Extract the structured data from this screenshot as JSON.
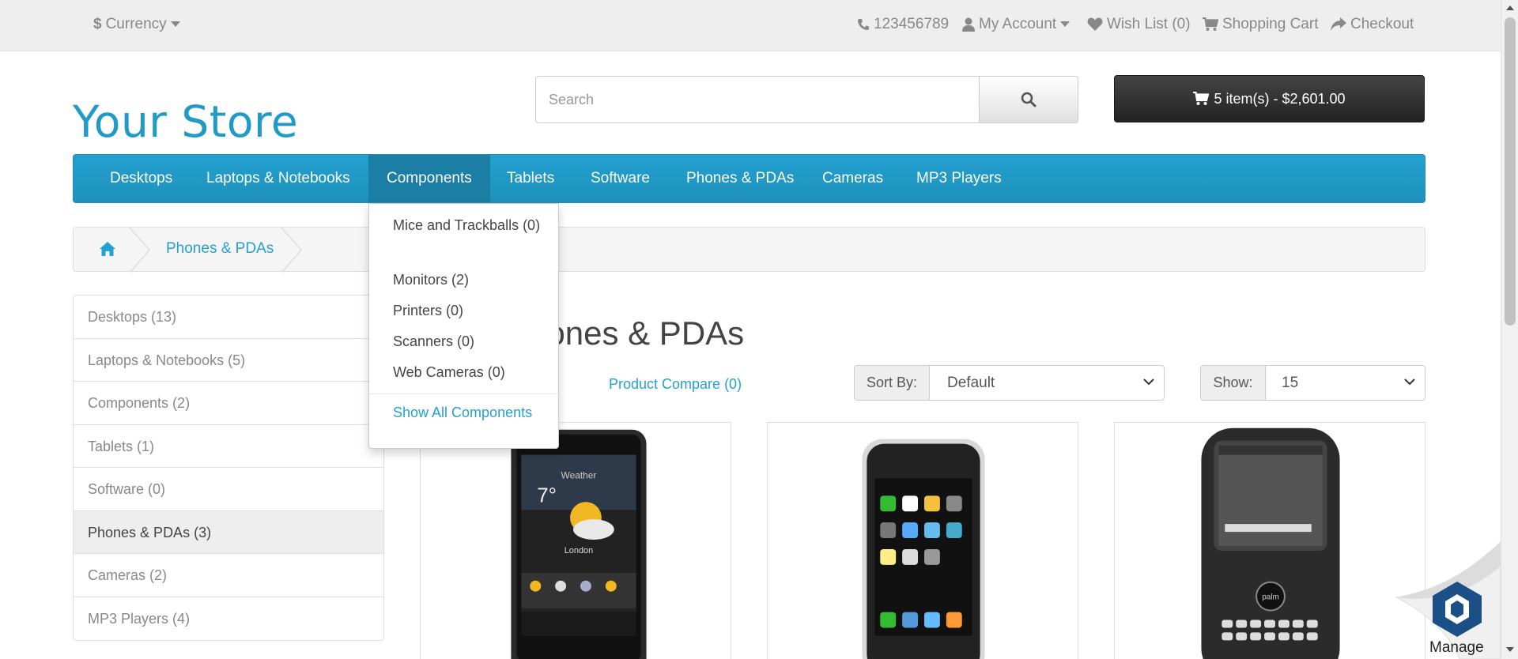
{
  "topbar": {
    "currency": "Currency",
    "phone": "123456789",
    "my_account": "My Account",
    "wish_list": "Wish List (0)",
    "shopping_cart": "Shopping Cart",
    "checkout": "Checkout"
  },
  "header": {
    "logo": "Your Store",
    "search_placeholder": "Search",
    "cart_button": "5 item(s) - $2,601.00"
  },
  "menu": {
    "items": [
      "Desktops",
      "Laptops & Notebooks",
      "Components",
      "Tablets",
      "Software",
      "Phones & PDAs",
      "Cameras",
      "MP3 Players"
    ],
    "active": "Components"
  },
  "components_dropdown": {
    "items": [
      "Mice and Trackballs (0)",
      "Monitors (2)",
      "Printers (0)",
      "Scanners (0)",
      "Web Cameras (0)"
    ],
    "show_all": "Show All Components"
  },
  "breadcrumb": {
    "current": "Phones & PDAs"
  },
  "sidebar": {
    "items": [
      "Desktops (13)",
      "Laptops & Notebooks (5)",
      "Components (2)",
      "Tablets (1)",
      "Software (0)",
      "Phones & PDAs (3)",
      "Cameras (2)",
      "MP3 Players (4)"
    ],
    "active": "Phones & PDAs (3)"
  },
  "content": {
    "title": "Phones & PDAs",
    "product_compare": "Product Compare (0)",
    "sort_label": "Sort By:",
    "sort_value": "Default",
    "show_label": "Show:",
    "show_value": "15"
  },
  "widget": {
    "manage_label": "Manage"
  },
  "colors": {
    "accent": "#229ac8",
    "menu_bg": "#23a1d1",
    "cart_bg": "#333333"
  }
}
